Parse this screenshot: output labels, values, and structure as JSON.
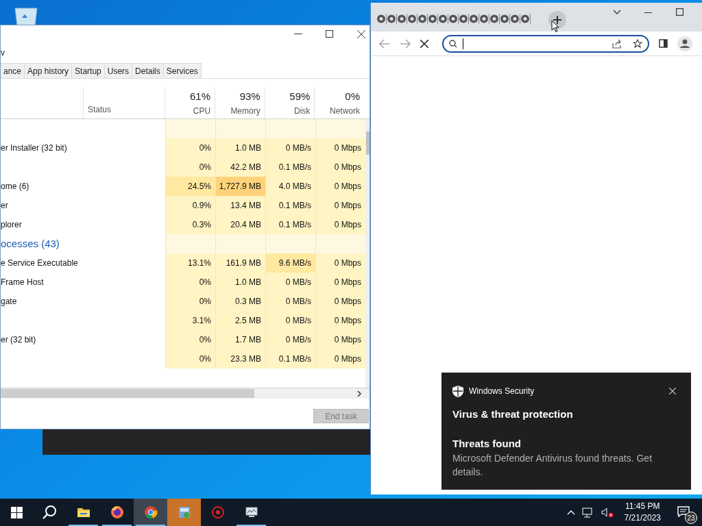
{
  "task_manager": {
    "menu": [
      "v"
    ],
    "tabs": [
      "ance",
      "App history",
      "Startup",
      "Users",
      "Details",
      "Services"
    ],
    "columns": [
      {
        "label": "Status"
      },
      {
        "percent": "61%",
        "label": "CPU"
      },
      {
        "percent": "93%",
        "label": "Memory"
      },
      {
        "percent": "59%",
        "label": "Disk"
      },
      {
        "percent": "0%",
        "label": "Network"
      }
    ],
    "rows": [
      {
        "kind": "group"
      },
      {
        "kind": "process",
        "name": "er Installer (32 bit)",
        "cells": [
          {
            "text": "0%",
            "color": "#fff4c4"
          },
          {
            "text": "1.0 MB",
            "color": "#fff4c4"
          },
          {
            "text": "0 MB/s",
            "color": "#fff4c4"
          },
          {
            "text": "0 Mbps",
            "color": "#fff4c4"
          }
        ]
      },
      {
        "kind": "process",
        "cells": [
          {
            "text": "0%",
            "color": "#fff4c4"
          },
          {
            "text": "42.2 MB",
            "color": "#fff4c4"
          },
          {
            "text": "0.1 MB/s",
            "color": "#fff4c4"
          },
          {
            "text": "0 Mbps",
            "color": "#fff4c4"
          }
        ]
      },
      {
        "kind": "process",
        "name": "ome (6)",
        "cells": [
          {
            "text": "24.5%",
            "color": "#ffe8a0"
          },
          {
            "text": "1,727.9 MB",
            "color": "#ffd27a"
          },
          {
            "text": "4.0 MB/s",
            "color": "#fff4c4"
          },
          {
            "text": "0 Mbps",
            "color": "#fff4c4"
          }
        ]
      },
      {
        "kind": "process",
        "name": "er",
        "cells": [
          {
            "text": "0.9%",
            "color": "#fff4c4"
          },
          {
            "text": "13.4 MB",
            "color": "#fff4c4"
          },
          {
            "text": "0.1 MB/s",
            "color": "#fff4c4"
          },
          {
            "text": "0 Mbps",
            "color": "#fff4c4"
          }
        ]
      },
      {
        "kind": "process",
        "name": "plorer",
        "cells": [
          {
            "text": "0.3%",
            "color": "#fff4c4"
          },
          {
            "text": "20.4 MB",
            "color": "#fff4c4"
          },
          {
            "text": "0.1 MB/s",
            "color": "#fff4c4"
          },
          {
            "text": "0 Mbps",
            "color": "#fff4c4"
          }
        ]
      },
      {
        "kind": "group",
        "name": "ocesses (43)"
      },
      {
        "kind": "process",
        "name": "e Service Executable",
        "cells": [
          {
            "text": "13.1%",
            "color": "#fff4c4"
          },
          {
            "text": "161.9 MB",
            "color": "#fff4c4"
          },
          {
            "text": "9.6 MB/s",
            "color": "#ffe8a0"
          },
          {
            "text": "0 Mbps",
            "color": "#fff4c4"
          }
        ]
      },
      {
        "kind": "process",
        "name": "Frame Host",
        "cells": [
          {
            "text": "0%",
            "color": "#fff4c4"
          },
          {
            "text": "1.0 MB",
            "color": "#fff4c4"
          },
          {
            "text": "0 MB/s",
            "color": "#fff4c4"
          },
          {
            "text": "0 Mbps",
            "color": "#fff4c4"
          }
        ]
      },
      {
        "kind": "process",
        "name": "gate",
        "cells": [
          {
            "text": "0%",
            "color": "#fff4c4"
          },
          {
            "text": "0.3 MB",
            "color": "#fff4c4"
          },
          {
            "text": "0 MB/s",
            "color": "#fff4c4"
          },
          {
            "text": "0 Mbps",
            "color": "#fff4c4"
          }
        ]
      },
      {
        "kind": "process",
        "cells": [
          {
            "text": "3.1%",
            "color": "#fff4c4"
          },
          {
            "text": "2.5 MB",
            "color": "#fff4c4"
          },
          {
            "text": "0 MB/s",
            "color": "#fff4c4"
          },
          {
            "text": "0 Mbps",
            "color": "#fff4c4"
          }
        ]
      },
      {
        "kind": "process",
        "name": "er (32 bit)",
        "cells": [
          {
            "text": "0%",
            "color": "#fff4c4"
          },
          {
            "text": "1.7 MB",
            "color": "#fff4c4"
          },
          {
            "text": "0 MB/s",
            "color": "#fff4c4"
          },
          {
            "text": "0 Mbps",
            "color": "#fff4c4"
          }
        ]
      },
      {
        "kind": "process",
        "cells": [
          {
            "text": "0%",
            "color": "#fff4c4"
          },
          {
            "text": "23.3 MB",
            "color": "#fff4c4"
          },
          {
            "text": "0.1 MB/s",
            "color": "#fff4c4"
          },
          {
            "text": "0 Mbps",
            "color": "#fff4c4"
          }
        ]
      }
    ],
    "end_task": {
      "label": "End task",
      "disabled": true
    }
  },
  "toast": {
    "app": "Windows Security",
    "title": "Virus & threat protection",
    "heading": "Threats found",
    "body": "Microsoft Defender Antivirus found threats. Get details."
  },
  "taskbar": {
    "apps": [
      {
        "kind": "folder",
        "running": true,
        "selected": false
      },
      {
        "kind": "firefox",
        "running": true,
        "selected": false
      },
      {
        "kind": "chrome",
        "running": true,
        "selected": true
      },
      {
        "kind": "network-app",
        "running": false,
        "selected": true
      },
      {
        "kind": "gear-app",
        "running": false,
        "selected": false
      },
      {
        "kind": "monitor-app",
        "running": true,
        "selected": false
      }
    ],
    "time": "11:45 PM",
    "date": "7/21/2023",
    "notifications": "23"
  }
}
